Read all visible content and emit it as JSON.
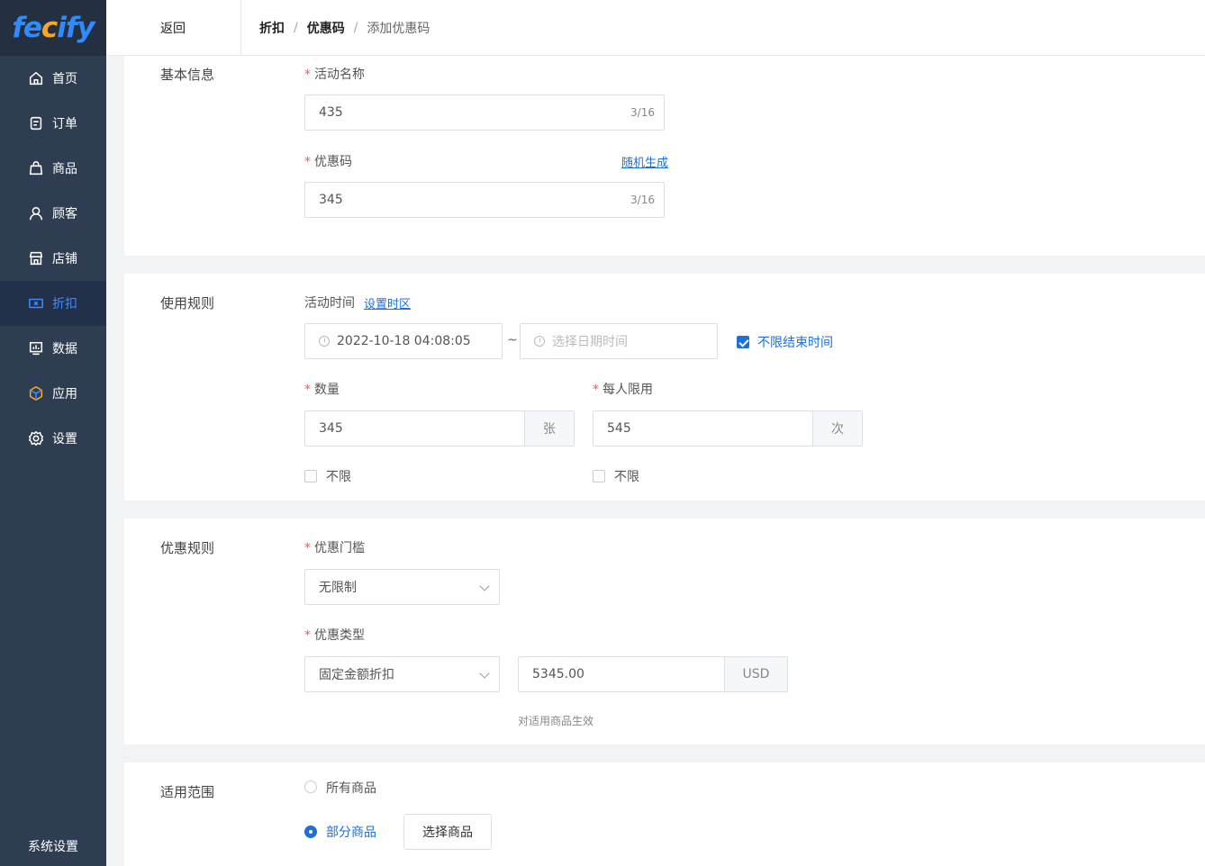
{
  "logo": {
    "text_a": "fe",
    "text_c": "c",
    "text_b": "ify"
  },
  "sidebar": {
    "items": [
      {
        "label": "首页",
        "icon": "home-icon"
      },
      {
        "label": "订单",
        "icon": "order-icon"
      },
      {
        "label": "商品",
        "icon": "bag-icon"
      },
      {
        "label": "顾客",
        "icon": "user-icon"
      },
      {
        "label": "店铺",
        "icon": "store-icon"
      },
      {
        "label": "折扣",
        "icon": "ticket-icon",
        "active": true
      },
      {
        "label": "数据",
        "icon": "chart-icon"
      },
      {
        "label": "应用",
        "icon": "box-icon"
      },
      {
        "label": "设置",
        "icon": "gear-icon"
      }
    ],
    "system_settings": "系统设置"
  },
  "header": {
    "back": "返回",
    "crumbs": [
      "折扣",
      "优惠码",
      "添加优惠码"
    ],
    "separator": "/"
  },
  "basic": {
    "title": "基本信息",
    "name_label": "活动名称",
    "name_value": "435",
    "name_counter": "3/16",
    "code_label": "优惠码",
    "code_random": "随机生成",
    "code_value": "345",
    "code_counter": "3/16",
    "required_mark": "*"
  },
  "usage": {
    "title": "使用规则",
    "time_label": "活动时间",
    "timezone_link": "设置时区",
    "start_time": "2022-10-18 04:08:05",
    "range_sep": "~",
    "end_placeholder": "选择日期时间",
    "no_end_label": "不限结束时间",
    "qty_label": "数量",
    "qty_value": "345",
    "qty_unit": "张",
    "per_label": "每人限用",
    "per_value": "545",
    "per_unit": "次",
    "unlimited_1": "不限",
    "unlimited_2": "不限"
  },
  "discount": {
    "title": "优惠规则",
    "threshold_label": "优惠门槛",
    "threshold_value": "无限制",
    "type_label": "优惠类型",
    "type_value": "固定金额折扣",
    "amount_value": "5345.00",
    "currency": "USD",
    "hint": "对适用商品生效"
  },
  "scope": {
    "title": "适用范围",
    "all": "所有商品",
    "partial": "部分商品",
    "choose_btn": "选择商品"
  },
  "colors": {
    "primary": "#1e6fd9",
    "sidebar": "#2f3d52",
    "required": "#ff5555"
  }
}
